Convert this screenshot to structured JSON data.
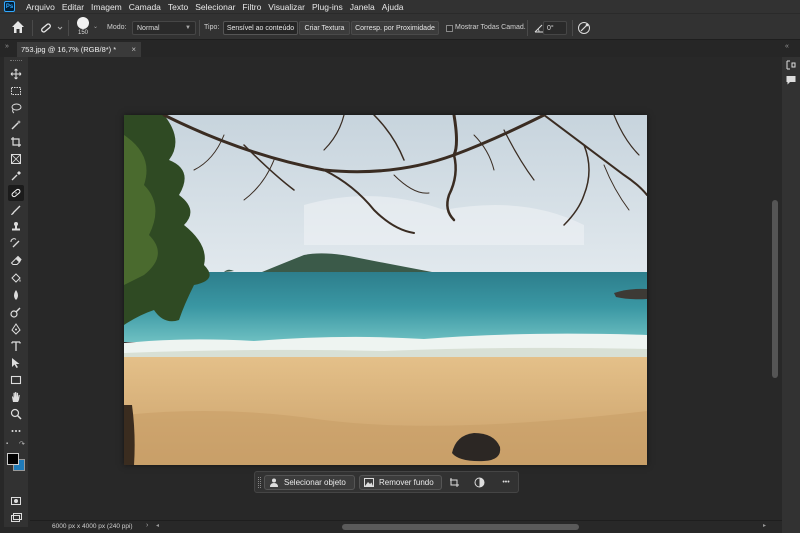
{
  "app": {
    "logo_text": "Ps"
  },
  "menu": [
    "Arquivo",
    "Editar",
    "Imagem",
    "Camada",
    "Texto",
    "Selecionar",
    "Filtro",
    "Visualizar",
    "Plug-ins",
    "Janela",
    "Ajuda"
  ],
  "options": {
    "brush_size": "150",
    "mode_label": "Modo:",
    "mode_value": "Normal",
    "type_label": "Tipo:",
    "type_buttons": [
      "Sensível ao conteúdo",
      "Criar Textura",
      "Corresp. por Proximidade"
    ],
    "type_active": "Sensível ao conteúdo",
    "sample_all_label": "Mostrar Todas Camad.",
    "sample_all_checked": false,
    "angle_value": "0°"
  },
  "document": {
    "tab_title": "753.jpg @ 16,7% (RGB/8*) *",
    "close_glyph": "×"
  },
  "taskbar": {
    "select_subject": "Selecionar objeto",
    "remove_background": "Remover fundo",
    "more_glyph": "•••"
  },
  "status": {
    "doc_size": "6000 px x 4000 px (240 ppi)"
  },
  "colors": {
    "foreground": "#000000",
    "background": "#1f7ab8",
    "accent": "#31a8ff"
  }
}
